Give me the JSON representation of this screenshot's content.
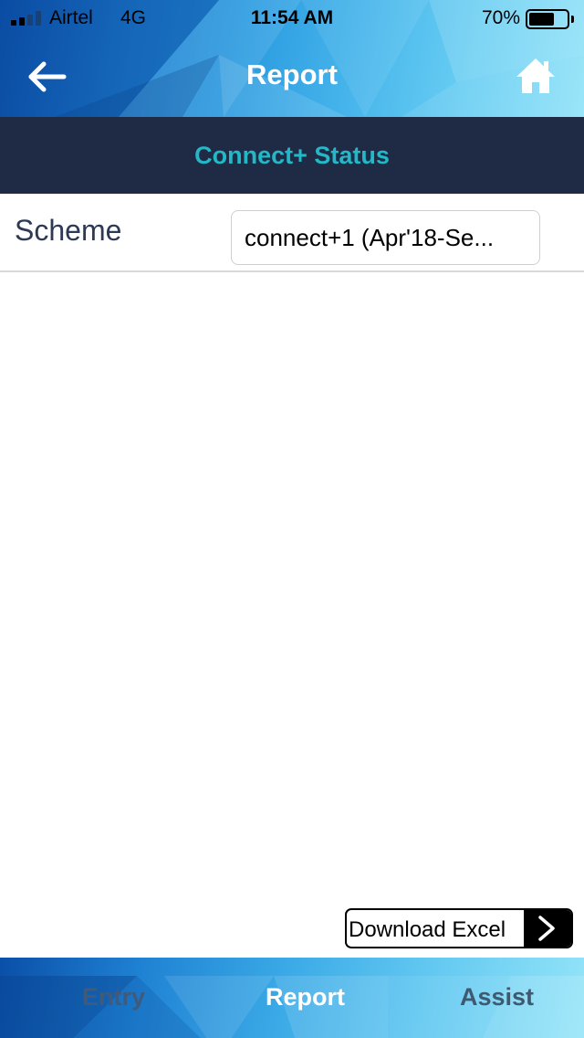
{
  "status_bar": {
    "carrier": "Airtel",
    "network": "4G",
    "time": "11:54 AM",
    "battery_percent": "70%",
    "battery_level": 0.7
  },
  "nav": {
    "title": "Report",
    "back_icon": "back-arrow-icon",
    "home_icon": "home-icon"
  },
  "section": {
    "title": "Connect+ Status"
  },
  "scheme": {
    "label": "Scheme",
    "selected": "connect+1 (Apr'18-Se..."
  },
  "download": {
    "label": "Download Excel",
    "icon": "chevron-right-icon"
  },
  "tabs": [
    {
      "label": "Entry",
      "active": false
    },
    {
      "label": "Report",
      "active": true
    },
    {
      "label": "Assist",
      "active": false
    }
  ],
  "colors": {
    "header_blue": "#1e7fd0",
    "section_bg": "#1f2b44",
    "section_text": "#22b8c8",
    "tab_active": "#ffffff",
    "tab_inactive": "#3f5a7a"
  }
}
